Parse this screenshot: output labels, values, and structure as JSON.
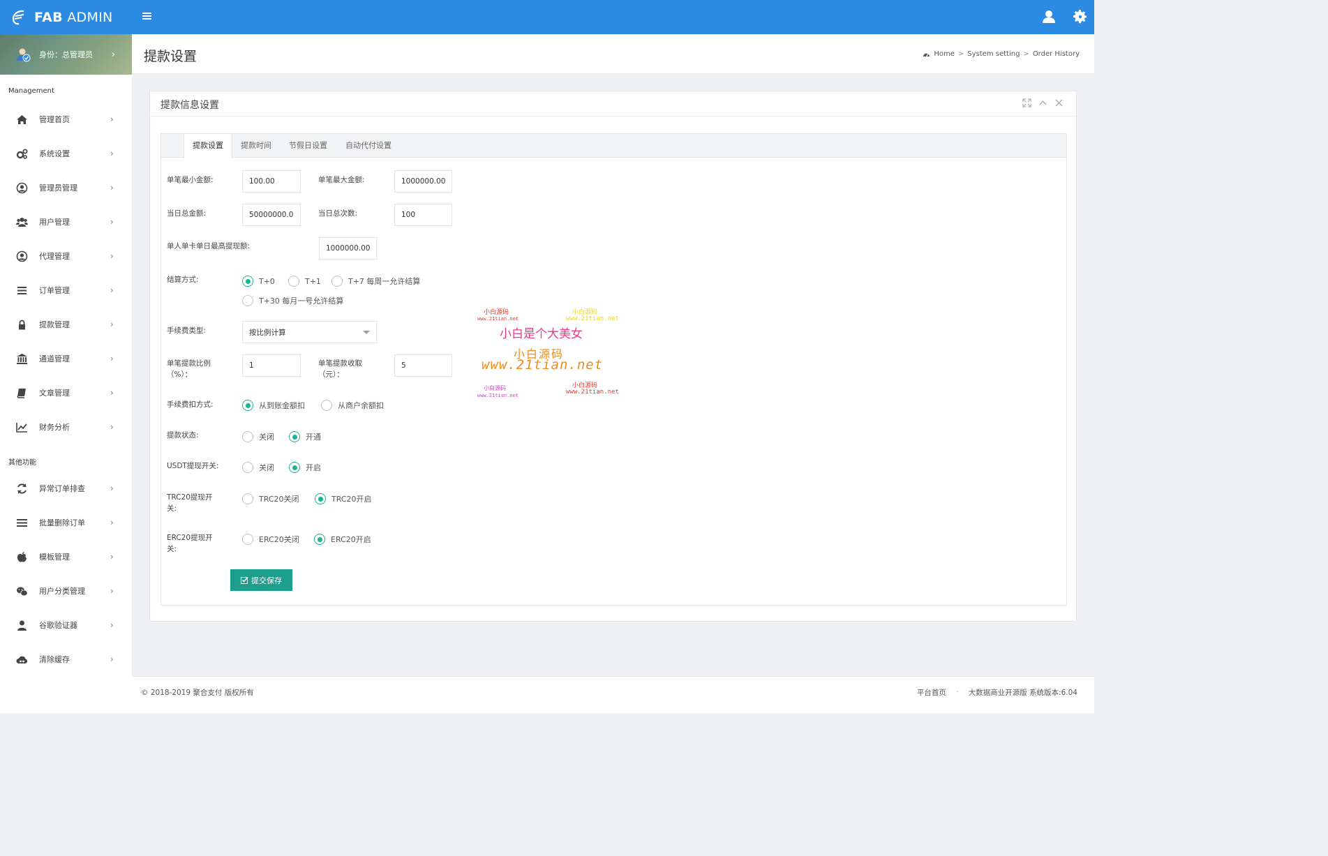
{
  "colors": {
    "primary": "#2b8ae2",
    "accent": "#1ab394",
    "submit": "#1c9e8c"
  },
  "brand": {
    "part1": "FAB",
    "part2": "ADMIN"
  },
  "profile": {
    "label": "身份：总管理员"
  },
  "sidebar": {
    "section1": "Management",
    "section2": "其他功能",
    "items": [
      {
        "label": "管理首页",
        "icon": "home-icon"
      },
      {
        "label": "系统设置",
        "icon": "cogs-icon"
      },
      {
        "label": "管理员管理",
        "icon": "user-circle-icon"
      },
      {
        "label": "用户管理",
        "icon": "users-icon"
      },
      {
        "label": "代理管理",
        "icon": "user-circle-icon"
      },
      {
        "label": "订单管理",
        "icon": "list-icon"
      },
      {
        "label": "提款管理",
        "icon": "lock-icon"
      },
      {
        "label": "通道管理",
        "icon": "bank-icon"
      },
      {
        "label": "文章管理",
        "icon": "book-icon"
      },
      {
        "label": "财务分析",
        "icon": "line-chart-icon"
      }
    ],
    "items2": [
      {
        "label": "异常订单排查",
        "icon": "refresh-icon"
      },
      {
        "label": "批量删除订单",
        "icon": "bars-icon"
      },
      {
        "label": "模板管理",
        "icon": "apple-icon"
      },
      {
        "label": "用户分类管理",
        "icon": "wechat-icon"
      },
      {
        "label": "谷歌验证器",
        "icon": "user-icon"
      },
      {
        "label": "清除缓存",
        "icon": "cloud-icon"
      }
    ]
  },
  "header": {
    "title": "提款设置",
    "breadcrumb": [
      "Home",
      "System setting",
      "Order History"
    ]
  },
  "card": {
    "title": "提款信息设置"
  },
  "tabs": [
    "提款设置",
    "提款时间",
    "节假日设置",
    "自动代付设置"
  ],
  "form": {
    "min_label": "单笔最小金额:",
    "min_value": "100.00",
    "max_label": "单笔最大金额:",
    "max_value": "1000000.00",
    "day_total_label": "当日总金额:",
    "day_total_value": "50000000.0",
    "day_count_label": "当日总次数:",
    "day_count_value": "100",
    "card_max_label": "单人单卡单日最高提现额:",
    "card_max_value": "1000000.00",
    "settle_label": "结算方式:",
    "settle_options": [
      "T+0",
      "T+1",
      "T+7 每周一允许结算",
      "T+30 每月一号允许结算"
    ],
    "fee_type_label": "手续费类型:",
    "fee_type_value": "按比例计算",
    "ratio_label_1": "单笔提款比例",
    "ratio_label_2": "（%）：",
    "ratio_value": "1",
    "fee_label_1": "单笔提款收取",
    "fee_label_2": "（元）：",
    "fee_value": "5",
    "deduct_label": "手续费扣方式:",
    "deduct_options": [
      "从到账金额扣",
      "从商户余额扣"
    ],
    "status_label": "提款状态:",
    "status_options": [
      "关闭",
      "开通"
    ],
    "usdt_label": "USDT提现开关:",
    "usdt_options": [
      "关闭",
      "开启"
    ],
    "trc_label_1": "TRC20提现开",
    "trc_label_2": "关:",
    "trc_options": [
      "TRC20关闭",
      "TRC20开启"
    ],
    "erc_label_1": "ERC20提现开",
    "erc_label_2": "关:",
    "erc_options": [
      "ERC20关闭",
      "ERC20开启"
    ],
    "submit": "提交保存"
  },
  "watermark": {
    "small_cn": "小白源码",
    "small_url": "www.21tian.net",
    "big_line1": "小白是个大美女",
    "big_line2": "小白源码",
    "big_line3": "www.21tian.net"
  },
  "footer": {
    "copyright": "© 2018-2019 聚合支付 版权所有",
    "link1": "平台首页",
    "link2": "大数据商业开源版 系统版本:6.04"
  }
}
